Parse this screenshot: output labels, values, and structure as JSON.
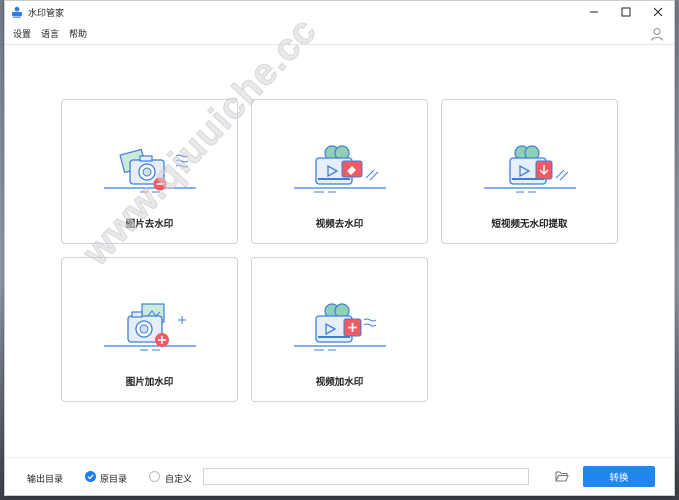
{
  "window": {
    "title": "水印管家"
  },
  "menu": {
    "items": [
      "设置",
      "语言",
      "帮助"
    ]
  },
  "cards": [
    {
      "label": "图片去水印",
      "icon": "camera-remove-icon"
    },
    {
      "label": "视频去水印",
      "icon": "video-remove-icon"
    },
    {
      "label": "短视频无水印提取",
      "icon": "video-extract-icon"
    },
    {
      "label": "图片加水印",
      "icon": "camera-add-icon"
    },
    {
      "label": "视频加水印",
      "icon": "video-add-icon"
    }
  ],
  "watermark": {
    "text": "www.qiuuiche.cc"
  },
  "footer": {
    "output_label": "输出目录",
    "option_original": "原目录",
    "option_custom": "自定义",
    "selected": "原目录",
    "path_value": "",
    "convert_label": "转换"
  },
  "colors": {
    "accent": "#1e88f0",
    "icon_blue": "#3f7fd6",
    "icon_red": "#ef5a63",
    "icon_green": "#8fd0b6"
  }
}
